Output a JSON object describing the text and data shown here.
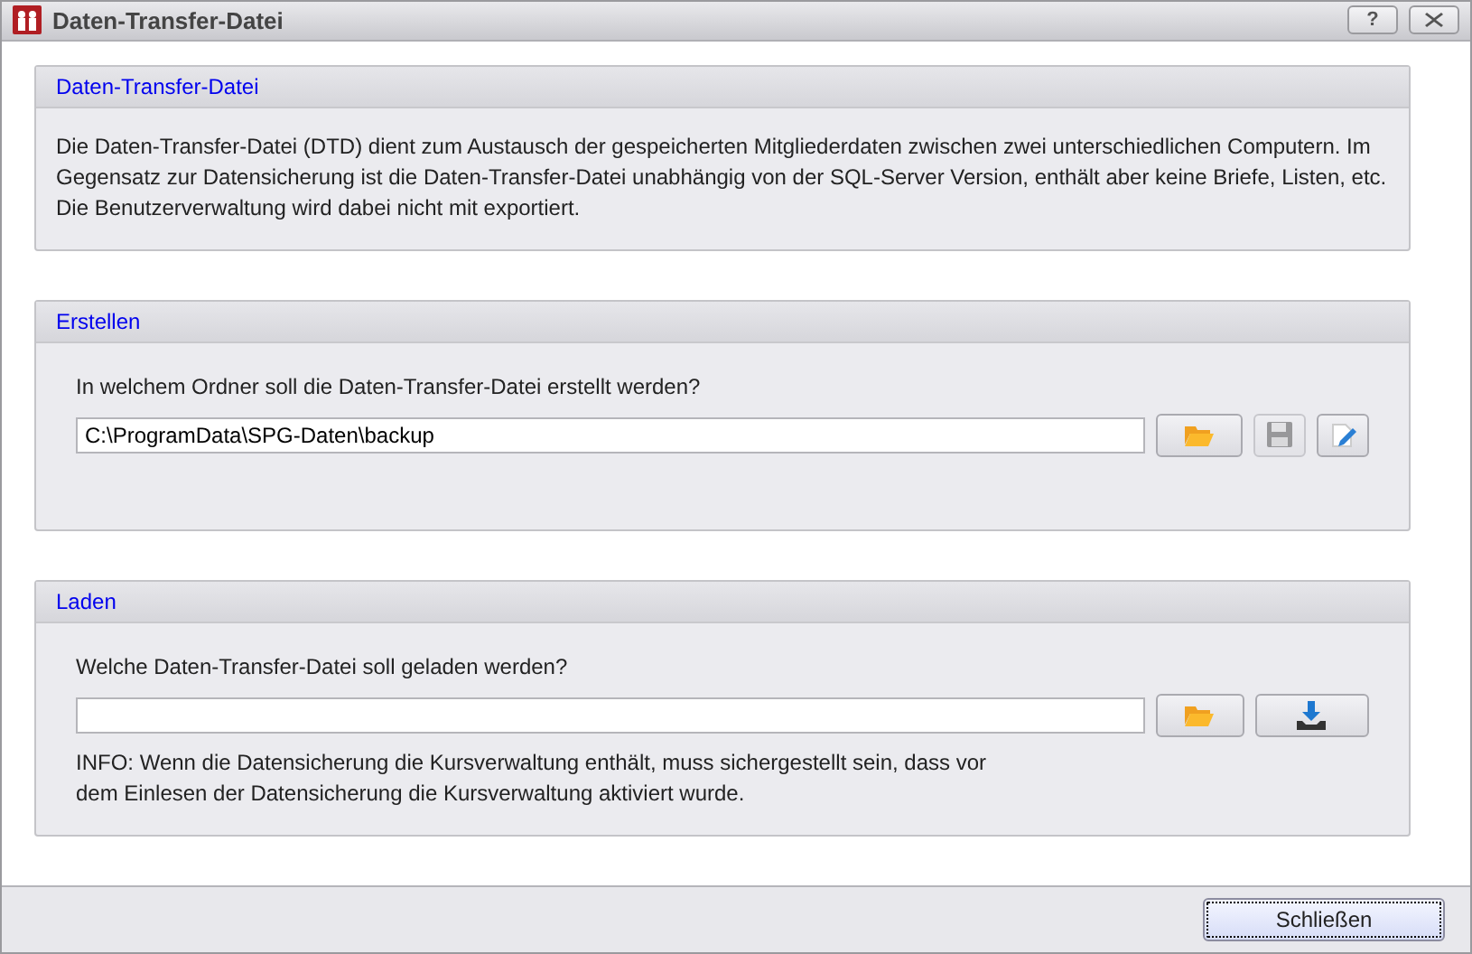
{
  "window": {
    "title": "Daten-Transfer-Datei",
    "help": "?"
  },
  "sections": [
    {
      "title": "Daten-Transfer-Datei",
      "text": "Die Daten-Transfer-Datei (DTD) dient zum Austausch der gespeicherten Mitgliederdaten zwischen zwei unterschiedlichen Computern. Im Gegensatz zur Datensicherung ist die Daten-Transfer-Datei unabhängig von der SQL-Server Version, enthält aber keine Briefe, Listen, etc. Die Benutzerverwaltung wird dabei nicht mit exportiert."
    },
    {
      "title": "Erstellen",
      "prompt": "In welchem Ordner soll die Daten-Transfer-Datei erstellt werden?",
      "value": "C:\\ProgramData\\SPG-Daten\\backup",
      "buttons": [
        {
          "kind": "folder",
          "disabled": false
        },
        {
          "kind": "save",
          "disabled": true
        },
        {
          "kind": "edit",
          "disabled": false
        }
      ]
    },
    {
      "title": "Laden",
      "prompt": "Welche Daten-Transfer-Datei soll geladen werden?",
      "buttons": [
        {
          "kind": "folder",
          "disabled": false
        },
        {
          "kind": "download",
          "disabled": false
        }
      ],
      "info": "INFO: Wenn die Datensicherung die Kursverwaltung enthält, muss sichergestellt sein, dass vor dem Einlesen der Datensicherung die Kursverwaltung aktiviert wurde."
    }
  ],
  "footer": {
    "button": {
      "label": "Schließen",
      "focused": true
    }
  }
}
